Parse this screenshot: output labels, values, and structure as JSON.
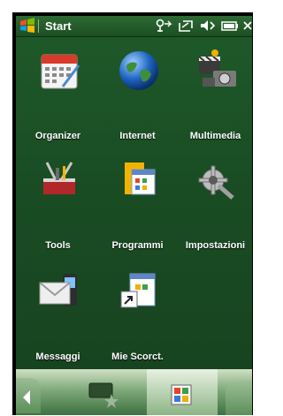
{
  "topbar": {
    "title": "Start",
    "start_icon": "windows-flag-icon",
    "status_icons": [
      "connectivity-icon",
      "sync-icon",
      "volume-icon",
      "battery-icon",
      "close-icon"
    ]
  },
  "tiles": [
    {
      "label": "Organizer",
      "icon": "calendar-icon"
    },
    {
      "label": "Internet",
      "icon": "globe-icon"
    },
    {
      "label": "Multimedia",
      "icon": "multimedia-icon"
    },
    {
      "label": "Tools",
      "icon": "toolbox-icon"
    },
    {
      "label": "Programmi",
      "icon": "folder-programs-icon"
    },
    {
      "label": "Impostazioni",
      "icon": "settings-gears-icon"
    },
    {
      "label": "Messaggi",
      "icon": "envelope-phone-icon"
    },
    {
      "label": "Mie Scorct.",
      "icon": "shortcut-icon"
    }
  ],
  "bottombar": {
    "tabs": [
      "favorites-tab-icon",
      "apps-grid-icon",
      "back-arrow-icon"
    ]
  },
  "colors": {
    "background": "#1a4d24",
    "text": "#ffffff"
  }
}
